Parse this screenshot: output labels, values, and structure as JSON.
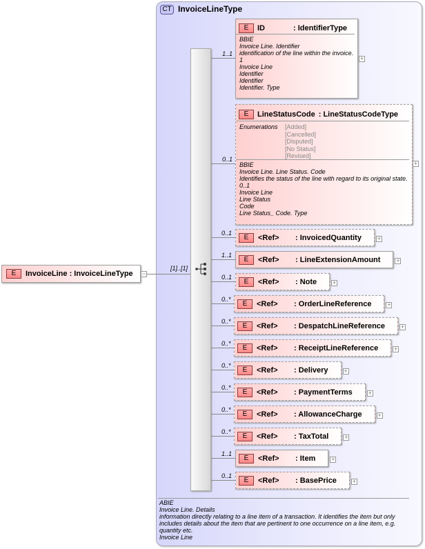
{
  "complex_type": {
    "badge": "CT",
    "name": "InvoiceLineType"
  },
  "root": {
    "badge": "E",
    "label": "InvoiceLine : InvoiceLineType",
    "multiplicity": "[1]..[1]",
    "toggle": "−"
  },
  "id_element": {
    "badge": "E",
    "name": "ID",
    "type": ": IdentifierType",
    "cardinality": "1..1",
    "doc": [
      "BBIE",
      "Invoice Line. Identifier",
      "identification of the line within the invoice.",
      "1",
      "Invoice Line",
      "Identifier",
      "Identifier",
      "Identifier. Type"
    ]
  },
  "line_status": {
    "badge": "E",
    "name": "LineStatusCode",
    "type": ": LineStatusCodeType",
    "cardinality": "0..1",
    "enum_label": "Enumerations",
    "enumerations": [
      "[Added]",
      "[Cancelled]",
      "[Disputed]",
      "[No Status]",
      "[Revised]"
    ],
    "doc": [
      "BBIE",
      "Invoice Line. Line Status. Code",
      "Identifies the status of the line with regard to its original state.",
      "0..1",
      "Invoice Line",
      "Line Status",
      "Code",
      "Line Status_ Code. Type"
    ]
  },
  "refs": [
    {
      "ref": "<Ref>",
      "name": ": InvoicedQuantity",
      "cardinality": "0..1",
      "optional": true
    },
    {
      "ref": "<Ref>",
      "name": ": LineExtensionAmount",
      "cardinality": "1..1",
      "optional": false
    },
    {
      "ref": "<Ref>",
      "name": ": Note",
      "cardinality": "0..1",
      "optional": true
    },
    {
      "ref": "<Ref>",
      "name": ": OrderLineReference",
      "cardinality": "0..*",
      "optional": true
    },
    {
      "ref": "<Ref>",
      "name": ": DespatchLineReference",
      "cardinality": "0..*",
      "optional": true
    },
    {
      "ref": "<Ref>",
      "name": ": ReceiptLineReference",
      "cardinality": "0..*",
      "optional": true
    },
    {
      "ref": "<Ref>",
      "name": ": Delivery",
      "cardinality": "0..*",
      "optional": true
    },
    {
      "ref": "<Ref>",
      "name": ": PaymentTerms",
      "cardinality": "0..*",
      "optional": true
    },
    {
      "ref": "<Ref>",
      "name": ": AllowanceCharge",
      "cardinality": "0..*",
      "optional": true
    },
    {
      "ref": "<Ref>",
      "name": ": TaxTotal",
      "cardinality": "0..*",
      "optional": true
    },
    {
      "ref": "<Ref>",
      "name": ": Item",
      "cardinality": "1..1",
      "optional": false
    },
    {
      "ref": "<Ref>",
      "name": ": BasePrice",
      "cardinality": "0..1",
      "optional": true
    }
  ],
  "annotation": [
    "ABIE",
    "Invoice Line. Details",
    "information directly relating to a line item of a transaction. It identifies the item but only",
    "includes details about the item that are pertinent  to one occurrence on a line item, e.g.",
    "quantity etc.",
    "Invoice Line"
  ],
  "expand_symbol": "+"
}
